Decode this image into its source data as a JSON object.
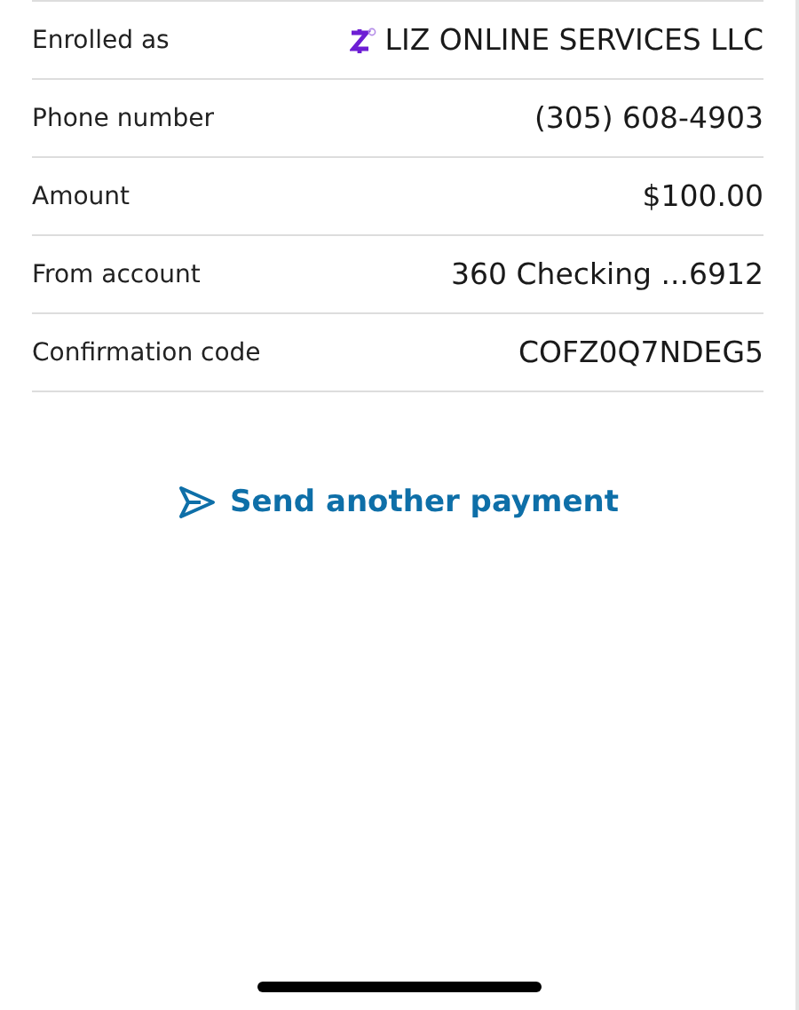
{
  "details": [
    {
      "kind": "recipient",
      "label": "Enrolled as",
      "value": "LIZ ONLINE SERVICES LLC"
    },
    {
      "kind": "plain",
      "label": "Phone number",
      "value": "(305) 608-4903"
    },
    {
      "kind": "plain",
      "label": "Amount",
      "value": "$100.00"
    },
    {
      "kind": "plain",
      "label": "From account",
      "value": "360 Checking ...6912"
    },
    {
      "kind": "plain",
      "label": "Confirmation code",
      "value": "COFZ0Q7NDEG5"
    }
  ],
  "action": {
    "label": "Send another payment"
  }
}
